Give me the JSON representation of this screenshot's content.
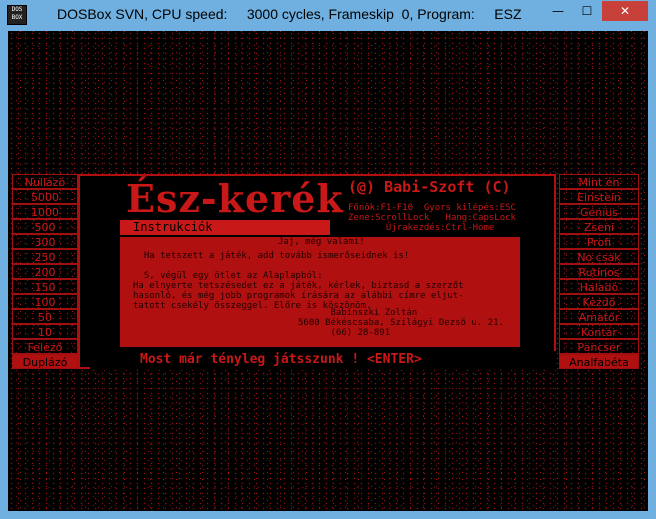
{
  "window": {
    "title": "DOSBox SVN, CPU speed:     3000 cycles, Frameskip  0, Program:     ESZ",
    "icon_text": "DOS BOX",
    "min_label": "—",
    "max_label": "☐",
    "close_label": "✕"
  },
  "game": {
    "title": "Ész-kerék",
    "copyright": "(@) Babi-Szoft (C)",
    "keys": "Főnök:F1-F10  Gyors kilépés:ESC\nZene:ScrollLock   Hang:CapsLock\n       Újrakezdés:Ctrl-Home",
    "tab": "Instrukciók",
    "box_heading": "Jaj, még valami!",
    "box_text": "  Ha tetszett a játék, add tovább ismerőseidnek is!\n\n  S, végül egy ötlet az Alaplapból:\nHa elnyerte tetszésedet ez a játék, kérlek, biztasd a szerzőt\nhasonló, és még jobb programok írására az alábbi címre eljut-\ntatott csekély összeggel. Előre is köszönöm.",
    "box_sign": "      Babinszki Zoltán\n5600 Békéscsaba, Szilágyi Dezső u. 21.\n      (66) 28-891",
    "bottom": "Most már tényleg játsszunk ! <ENTER>",
    "left_scores": [
      "Nullázó",
      "5000",
      "1000",
      "500",
      "300",
      "250",
      "200",
      "150",
      "100",
      "50",
      "10",
      "Felező",
      "Duplázó"
    ],
    "right_ranks": [
      "Mint én",
      "Einstein",
      "Genius",
      "Zseni",
      "Profi",
      "No csak",
      "Rutinos",
      "Haladó",
      "Kezdő",
      "Amatőr",
      "Kontár",
      "Pancser",
      "Analfabéta"
    ]
  }
}
